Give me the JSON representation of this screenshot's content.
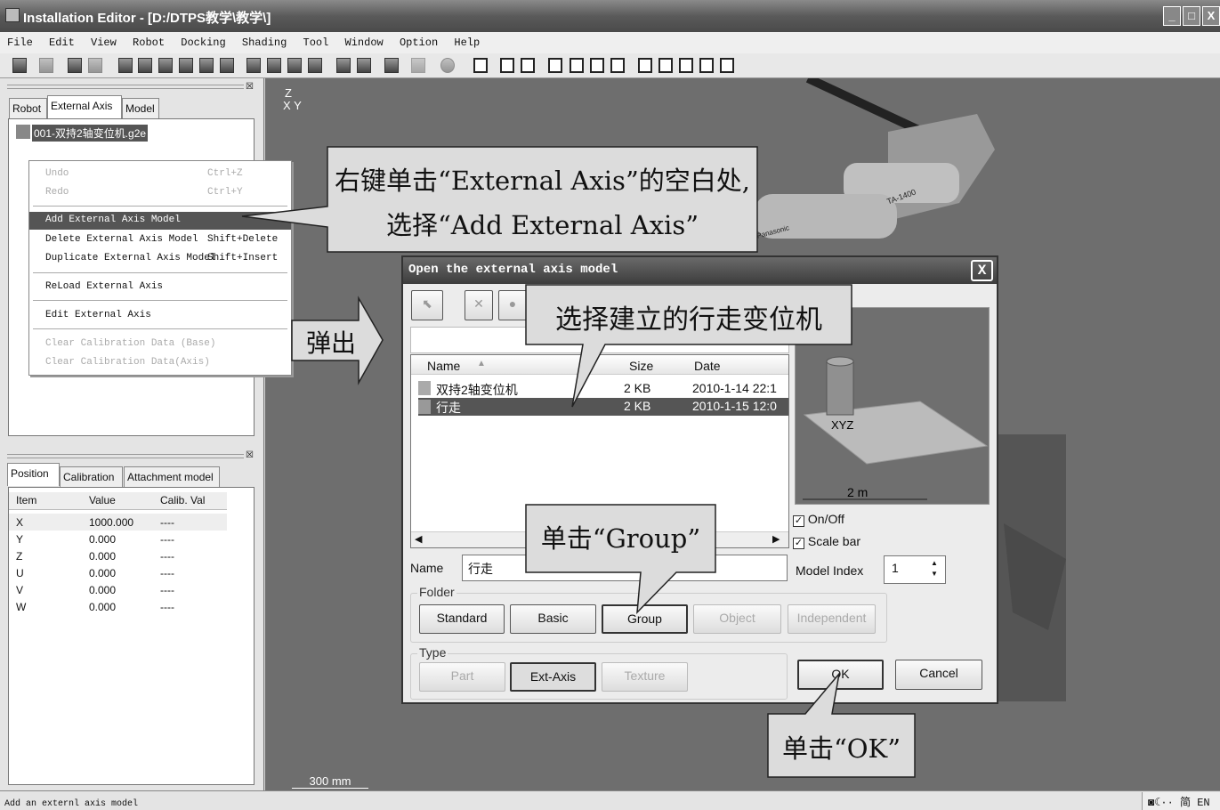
{
  "window": {
    "title": "Installation Editor - [D:/DTPS教学\\教学\\]",
    "min": "_",
    "max": "□",
    "close": "X"
  },
  "menu": [
    "File",
    "Edit",
    "View",
    "Robot",
    "Docking",
    "Shading",
    "Tool",
    "Window",
    "Option",
    "Help"
  ],
  "left_top": {
    "tabs": [
      "Robot",
      "External Axis",
      "Model"
    ],
    "tree_item": "001-双持2轴变位机.g2e"
  },
  "context_menu": {
    "undo": "Undo",
    "undo_sc": "Ctrl+Z",
    "redo": "Redo",
    "redo_sc": "Ctrl+Y",
    "add": "Add External Axis Model",
    "delete": "Delete External Axis Model",
    "delete_sc": "Shift+Delete",
    "duplicate": "Duplicate External Axis Model",
    "duplicate_sc": "Shift+Insert",
    "reload": "ReLoad External Axis",
    "edit": "Edit External Axis",
    "clear_base": "Clear Calibration Data (Base)",
    "clear_axis": "Clear Calibration Data(Axis)"
  },
  "left_bottom": {
    "tabs": [
      "Position",
      "Calibration",
      "Attachment model"
    ],
    "columns": [
      "Item",
      "Value",
      "Calib. Val"
    ],
    "rows": [
      [
        "X",
        "1000.000",
        "----"
      ],
      [
        "Y",
        "0.000",
        "----"
      ],
      [
        "Z",
        "0.000",
        "----"
      ],
      [
        "U",
        "0.000",
        "----"
      ],
      [
        "V",
        "0.000",
        "----"
      ],
      [
        "W",
        "0.000",
        "----"
      ]
    ]
  },
  "viewport": {
    "axis_z": "Z",
    "axis_x": "X",
    "axis_y": "Y",
    "scale": "300 mm",
    "robot_label": "TA-1400",
    "robot_brand": "Panasonic"
  },
  "dialog": {
    "title": "Open the external axis model",
    "close": "X",
    "columns": [
      "Name",
      "Size",
      "Date"
    ],
    "files": [
      {
        "name": "双持2轴变位机",
        "size": "2 KB",
        "date": "2010-1-14 22:1"
      },
      {
        "name": "行走",
        "size": "2 KB",
        "date": "2010-1-15 12:0"
      }
    ],
    "preview_scale": "2 m",
    "preview_axes": "XYZ",
    "onoff": "On/Off",
    "scalebar": "Scale bar",
    "name_label": "Name",
    "name_value": "行走",
    "model_index_label": "Model Index",
    "model_index": "1",
    "folder_label": "Folder",
    "folder_buttons": [
      "Standard",
      "Basic",
      "Group",
      "Object",
      "Independent"
    ],
    "type_label": "Type",
    "type_buttons": [
      "Part",
      "Ext-Axis",
      "Texture"
    ],
    "ok": "OK",
    "cancel": "Cancel"
  },
  "callouts": {
    "c1_line1": "右键单击“External Axis”的空白处,",
    "c1_line2": "选择“Add External Axis”",
    "popup": "弹出",
    "select": "选择建立的行走变位机",
    "group": "单击“Group”",
    "ok": "单击“OK”"
  },
  "status": {
    "text": "Add an externl axis model",
    "tray": "简 EN"
  }
}
